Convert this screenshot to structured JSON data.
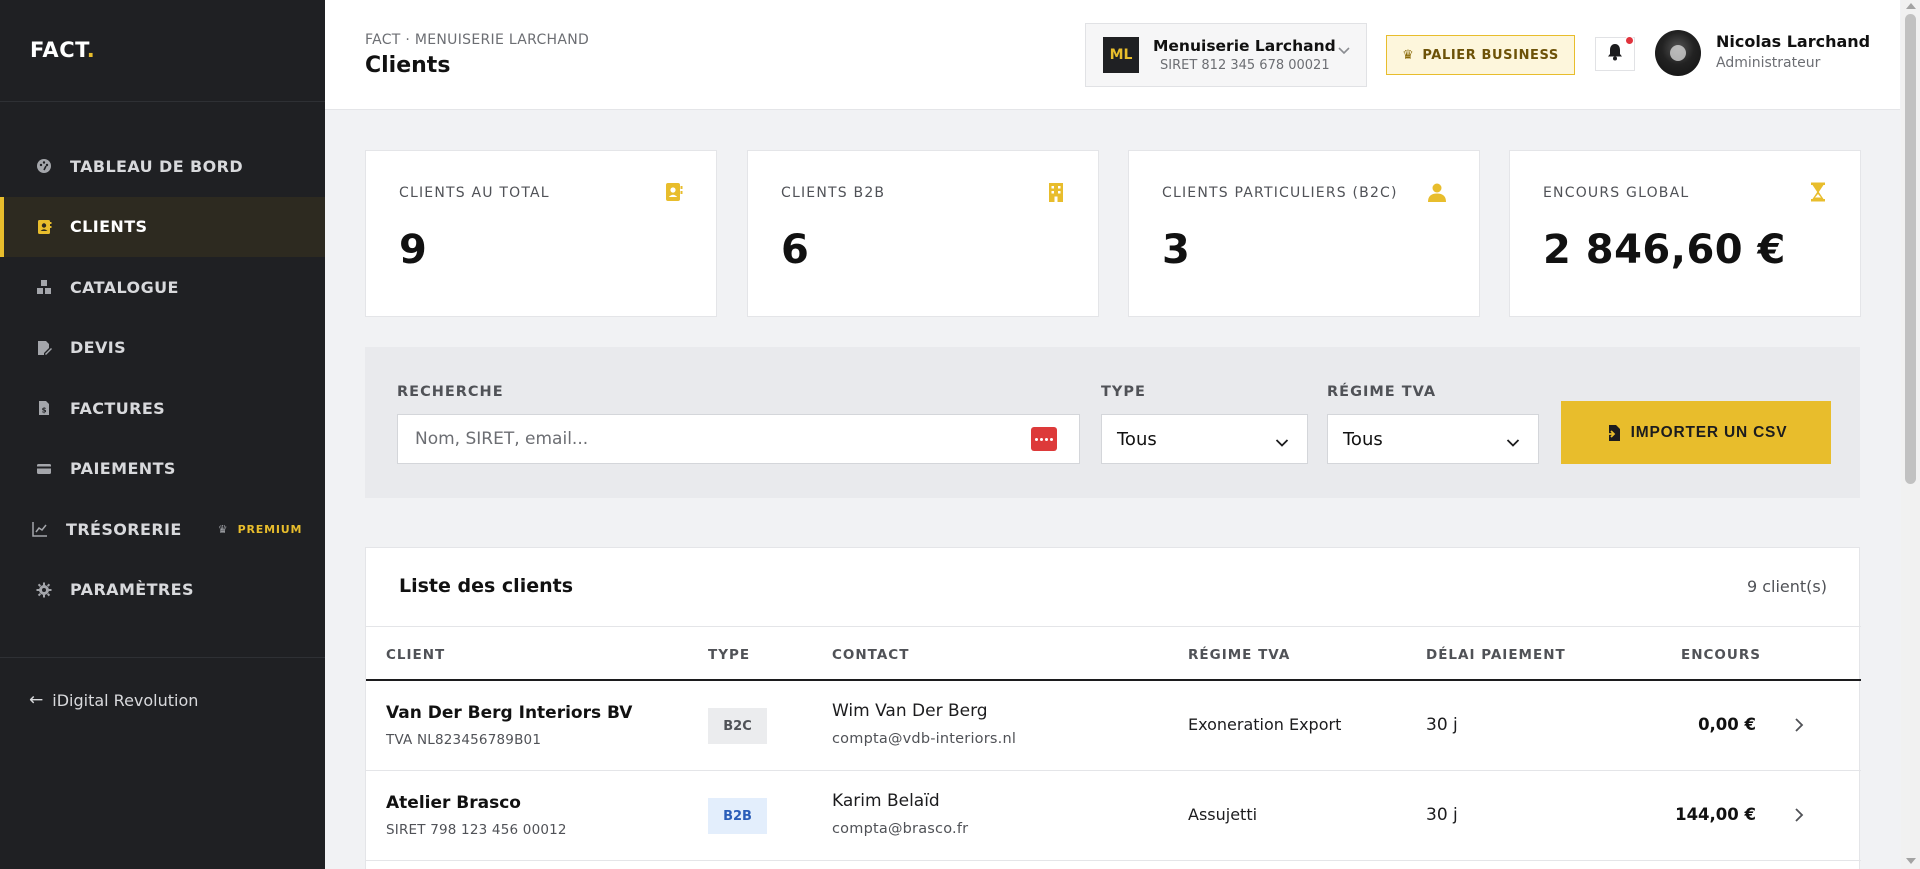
{
  "sidebar": {
    "logo": "FACT",
    "logo_dot": ".",
    "items": [
      {
        "label": "TABLEAU DE BORD",
        "icon": "dashboard-icon",
        "active": false
      },
      {
        "label": "CLIENTS",
        "icon": "contacts-icon",
        "active": true
      },
      {
        "label": "CATALOGUE",
        "icon": "boxes-icon",
        "active": false
      },
      {
        "label": "DEVIS",
        "icon": "quote-edit-icon",
        "active": false
      },
      {
        "label": "FACTURES",
        "icon": "invoice-icon",
        "active": false
      },
      {
        "label": "PAIEMENTS",
        "icon": "credit-card-icon",
        "active": false
      },
      {
        "label": "TRÉSORERIE",
        "icon": "chart-line-icon",
        "active": false,
        "badge": "PREMIUM"
      },
      {
        "label": "PARAMÈTRES",
        "icon": "gear-icon",
        "active": false
      }
    ],
    "back_label": "iDigital Revolution"
  },
  "header": {
    "breadcrumb": "FACT · MENUISERIE LARCHAND",
    "title": "Clients",
    "company": {
      "initials": "ML",
      "name": "Menuiserie Larchand",
      "siret": "SIRET 812 345 678 00021"
    },
    "tier": "PALIER BUSINESS",
    "user": {
      "name": "Nicolas Larchand",
      "role": "Administrateur"
    }
  },
  "stats": [
    {
      "label": "CLIENTS AU TOTAL",
      "value": "9",
      "icon": "contact-book-icon"
    },
    {
      "label": "CLIENTS B2B",
      "value": "6",
      "icon": "building-icon"
    },
    {
      "label": "CLIENTS PARTICULIERS (B2C)",
      "value": "3",
      "icon": "person-icon"
    },
    {
      "label": "ENCOURS GLOBAL",
      "value": "2 846,60 €",
      "icon": "hourglass-icon"
    }
  ],
  "filters": {
    "search_label": "RECHERCHE",
    "search_placeholder": "Nom, SIRET, email...",
    "type_label": "TYPE",
    "type_value": "Tous",
    "tva_label": "RÉGIME TVA",
    "tva_value": "Tous",
    "import_label": "IMPORTER UN CSV"
  },
  "list": {
    "title": "Liste des clients",
    "count": "9 client(s)",
    "columns": [
      "CLIENT",
      "TYPE",
      "CONTACT",
      "RÉGIME TVA",
      "DÉLAI PAIEMENT",
      "ENCOURS"
    ],
    "rows": [
      {
        "name": "Van Der Berg Interiors BV",
        "sub": "TVA NL823456789B01",
        "type": "B2C",
        "contact": "Wim Van Der Berg",
        "email": "compta@vdb-interiors.nl",
        "tva": "Exoneration Export",
        "delay": "30 j",
        "amount": "0,00 €"
      },
      {
        "name": "Atelier Brasco",
        "sub": "SIRET 798 123 456 00012",
        "type": "B2B",
        "contact": "Karim Belaïd",
        "email": "compta@brasco.fr",
        "tva": "Assujetti",
        "delay": "30 j",
        "amount": "144,00 €"
      }
    ]
  },
  "colors": {
    "accent": "#e8bd2c",
    "sidebar_bg": "#1f2023",
    "b2b_badge": "#2a5db8",
    "notification": "#e0323c"
  }
}
